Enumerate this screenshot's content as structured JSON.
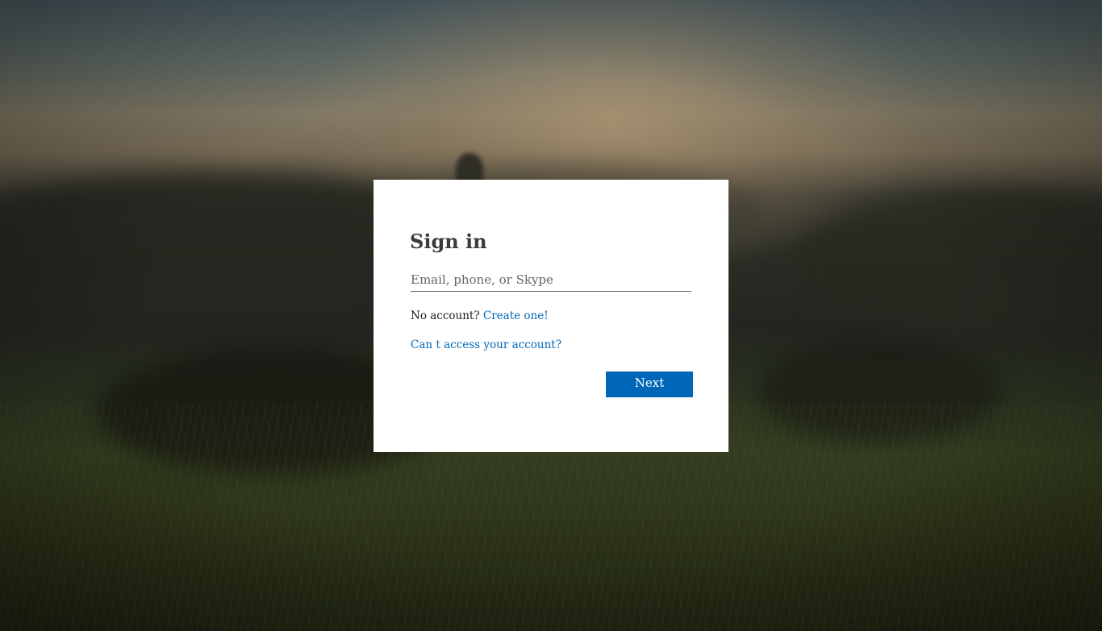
{
  "signin": {
    "title": "Sign in",
    "email_placeholder": "Email, phone, or Skype",
    "email_value": "",
    "no_account_text": "No account?",
    "create_link": "Create one!",
    "cant_access_link": "Can t access your account?",
    "next_label": "Next"
  },
  "colors": {
    "accent": "#0067b8",
    "card_background": "#ffffff",
    "title_text": "#3b3b3b"
  }
}
